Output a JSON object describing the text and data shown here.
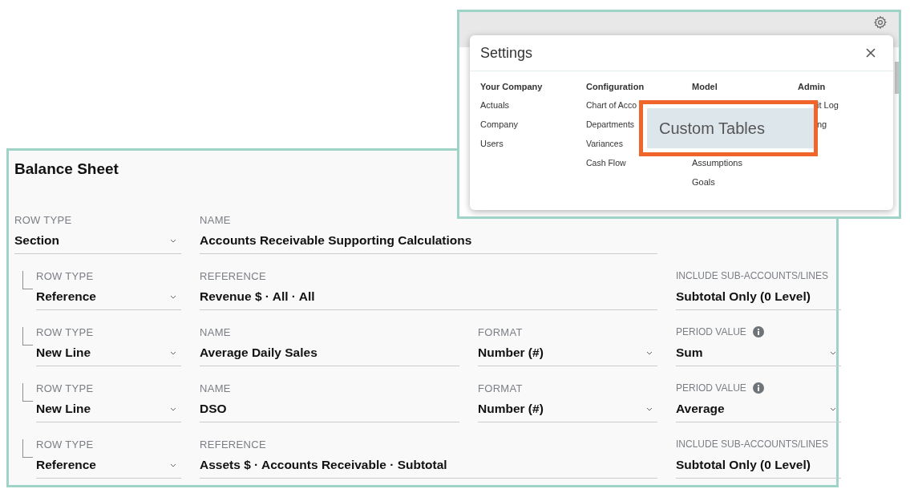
{
  "balance_sheet": {
    "title": "Balance Sheet",
    "rows": [
      {
        "nested": false,
        "row_type": {
          "label": "ROW TYPE",
          "value": "Section"
        },
        "main": [
          {
            "kind": "text",
            "label": "NAME",
            "value": "Accounts Receivable Supporting Calculations"
          }
        ],
        "side": null
      },
      {
        "nested": true,
        "row_type": {
          "label": "ROW TYPE",
          "value": "Reference"
        },
        "main": [
          {
            "kind": "text",
            "label": "REFERENCE",
            "value": "Revenue $ · All · All"
          }
        ],
        "side": {
          "kind": "text",
          "label": "INCLUDE SUB-ACCOUNTS/LINES",
          "value": "Subtotal Only (0 Level)",
          "info": false
        }
      },
      {
        "nested": true,
        "row_type": {
          "label": "ROW TYPE",
          "value": "New Line"
        },
        "main": [
          {
            "kind": "text",
            "label": "NAME",
            "value": "Average Daily Sales"
          },
          {
            "kind": "select",
            "label": "FORMAT",
            "value": "Number (#)"
          }
        ],
        "side": {
          "kind": "select",
          "label": "PERIOD VALUE",
          "value": "Sum",
          "info": true
        }
      },
      {
        "nested": true,
        "row_type": {
          "label": "ROW TYPE",
          "value": "New Line"
        },
        "main": [
          {
            "kind": "text",
            "label": "NAME",
            "value": "DSO"
          },
          {
            "kind": "select",
            "label": "FORMAT",
            "value": "Number (#)"
          }
        ],
        "side": {
          "kind": "select",
          "label": "PERIOD VALUE",
          "value": "Average",
          "info": true
        }
      },
      {
        "nested": true,
        "row_type": {
          "label": "ROW TYPE",
          "value": "Reference"
        },
        "main": [
          {
            "kind": "text",
            "label": "REFERENCE",
            "value": "Assets $ · Accounts Receivable · Subtotal"
          }
        ],
        "side": {
          "kind": "text",
          "label": "INCLUDE SUB-ACCOUNTS/LINES",
          "value": "Subtotal Only (0 Level)",
          "info": false
        }
      }
    ]
  },
  "settings_dialog": {
    "title": "Settings",
    "columns": [
      {
        "heading": "Your Company",
        "items": [
          "Actuals",
          "Company",
          "Users"
        ]
      },
      {
        "heading": "Configuration",
        "items": [
          "Chart of Acco",
          "Departments",
          "Variances",
          "Cash Flow"
        ]
      },
      {
        "heading": "Model",
        "items": [
          "Assumptions",
          "Goals"
        ]
      },
      {
        "heading": "Admin",
        "items": [
          "it Log",
          "ng"
        ]
      }
    ],
    "callout": {
      "label": "Custom Tables"
    }
  }
}
